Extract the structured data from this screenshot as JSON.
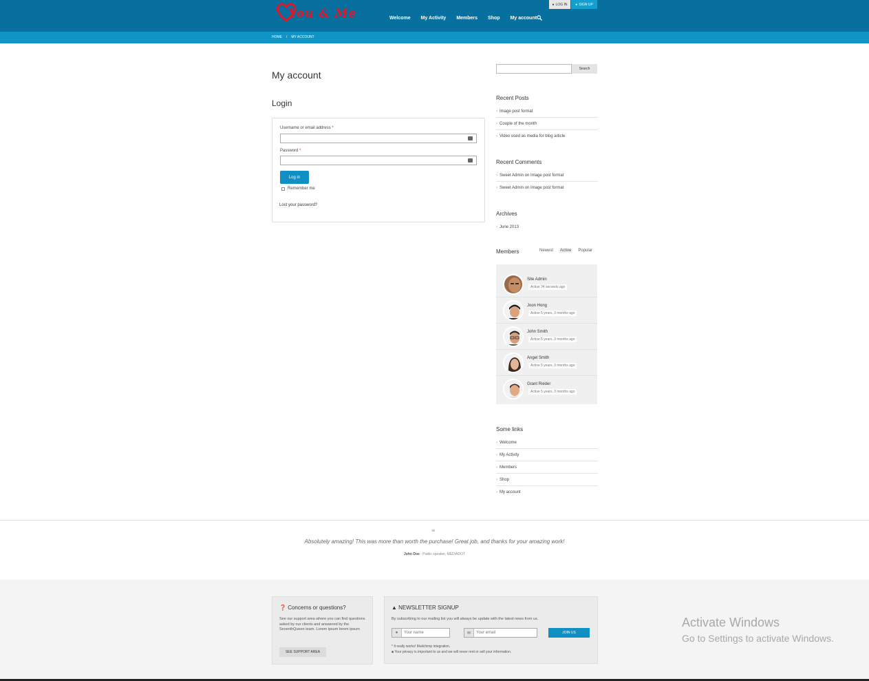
{
  "header": {
    "logo_text": "You & Me",
    "nav": [
      "Welcome",
      "My Activity",
      "Members",
      "Shop",
      "My account"
    ],
    "auth": {
      "login": "LOG IN",
      "signup": "SIGN UP"
    }
  },
  "breadcrumb": [
    "HOME",
    "/",
    "MY ACCOUNT"
  ],
  "main": {
    "page_title": "My account",
    "login_title": "Login",
    "username_label": "Username or email address",
    "password_label": "Password",
    "required_mark": "*",
    "login_button": "Log in",
    "remember_label": "Remember me",
    "lost_password": "Lost your password?"
  },
  "sidebar": {
    "search_button": "Search",
    "recent_posts_title": "Recent Posts",
    "recent_posts": [
      "Image post format",
      "Couple of the month",
      "Video used as media for blog article"
    ],
    "recent_comments_title": "Recent Comments",
    "recent_comments": [
      "Sweet Admin on Image post format",
      "Sweet Admin on Image post format"
    ],
    "archives_title": "Archives",
    "archives": [
      "June 2013"
    ],
    "members_title": "Members",
    "member_tabs": [
      "Newest",
      "Active",
      "Popular"
    ],
    "members": [
      {
        "name": "Site Admin",
        "active": "Active 34 seconds ago"
      },
      {
        "name": "Joon Hong",
        "active": "Active 5 years, 3 months ago"
      },
      {
        "name": "John Smith",
        "active": "Active 5 years, 3 months ago"
      },
      {
        "name": "Angel Smith",
        "active": "Active 5 years, 3 months ago"
      },
      {
        "name": "Grant Rieder",
        "active": "Active 5 years, 3 months ago"
      }
    ],
    "links_title": "Some links",
    "links": [
      "Welcome",
      "My Activity",
      "Members",
      "Shop",
      "My account"
    ]
  },
  "testimonial": {
    "quote": "Absolutely amazing! This was more than worth the purchase! Great job, and thanks for your amazing work!",
    "author": "John Doe",
    "author_role": " - Public speaker, MEDIADOT"
  },
  "footer": {
    "concerns_title": "Concerns or questions?",
    "concerns_text": "See our support area where you can find questions asked by our clients and answered by the SeventhQueen team. Lorem ipsum lorem ipsum",
    "support_button": "SEE SUPPORT AREA",
    "newsletter_title": "NEWSLETTER SIGNUP",
    "newsletter_text": "By subscribing to our mailing list you will always be update with the latest news from us.",
    "name_placeholder": "Your name",
    "email_placeholder": "Your email",
    "join_button": "JOIN US",
    "note1": "* It really works! Mailchimp integration.",
    "note2": "Your privacy is important to us and we will never rent or sell your information."
  },
  "os_overlay": {
    "line1": "Activate Windows",
    "line2": "Go to Settings to activate Windows."
  },
  "colors": {
    "header": "#08709f",
    "breadcrumb_bar": "#0f94c5",
    "accent": "#0f8fc2",
    "logo": "#e0182b"
  }
}
